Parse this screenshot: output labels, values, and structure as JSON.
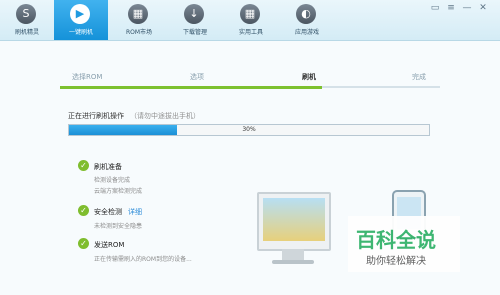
{
  "tabs": [
    {
      "label": "刷机精灵",
      "icon": "S"
    },
    {
      "label": "一键刷机",
      "icon": "▶"
    },
    {
      "label": "ROM市场",
      "icon": "▦"
    },
    {
      "label": "下载管理",
      "icon": "↓"
    },
    {
      "label": "实用工具",
      "icon": "▦"
    },
    {
      "label": "应用游戏",
      "icon": "◐"
    }
  ],
  "steps": [
    "选择ROM",
    "选项",
    "刷机",
    "完成"
  ],
  "status": {
    "title": "正在进行刷机操作",
    "hint": "（请勿中途拔出手机）"
  },
  "progress": {
    "value": 0.3,
    "label": "30%"
  },
  "items": [
    {
      "title": "刷机准备",
      "desc1": "检测设备完成",
      "desc2": "云端方案检测完成"
    },
    {
      "title": "安全检测",
      "detail": "详细",
      "desc1": "未检测到安全隐患"
    },
    {
      "title": "发送ROM",
      "desc1": "正在传输需刷入的ROM到您的设备..."
    }
  ],
  "watermark": {
    "line1": "百科全说",
    "line2": "助你轻松解决"
  },
  "colors": {
    "accent": "#1f9ae0",
    "success": "#7dc12f"
  }
}
